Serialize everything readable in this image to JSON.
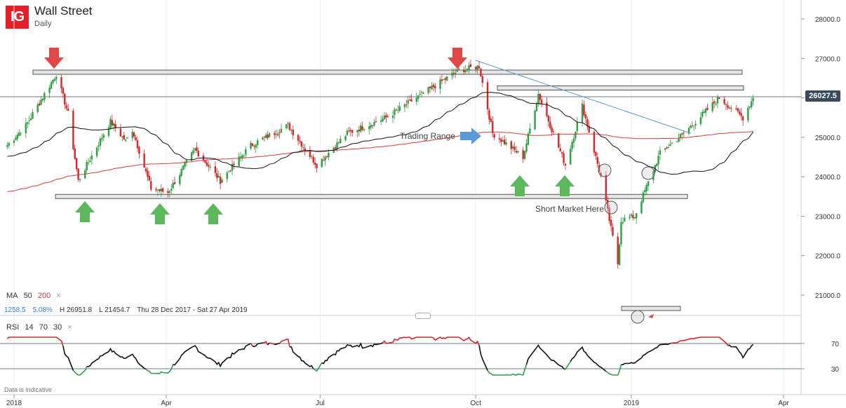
{
  "header": {
    "title": "Wall Street",
    "subtitle": "Daily",
    "logo_text": "IG"
  },
  "ma_legend": {
    "label": "MA",
    "period1": "50",
    "period2": "200",
    "close": "×"
  },
  "stats": {
    "change": "1258.5",
    "change_pct": "5.08%",
    "high": "H 26951.8",
    "low": "L 21454.7",
    "range": "Thu 28 Dec 2017 - Sat 27 Apr 2019"
  },
  "rsi_legend": {
    "label": "RSI",
    "p1": "14",
    "p2": "70",
    "p3": "30",
    "close": "×"
  },
  "disclaimer": "Data is indicative",
  "current_price": "26027.5",
  "colors": {
    "up": "#2ea043",
    "down": "#d9252a",
    "ma50": "#111111",
    "ma200": "#d63a3a",
    "trend": "#5b9bd5",
    "arrow_green": "#5cb85c",
    "arrow_red": "#e04848",
    "arrow_blue": "#5b9bd5",
    "price_tag": "#3a4a5c"
  },
  "chart_data": {
    "type": "candlestick",
    "title": "Wall Street",
    "subtitle": "Daily",
    "y_axis": {
      "ticks": [
        "21000.0",
        "22000.0",
        "23000.0",
        "24000.0",
        "25000.0",
        "26000.0",
        "27000.0",
        "28000.0"
      ],
      "range": [
        20500,
        28300
      ]
    },
    "x_axis": {
      "ticks": [
        "2018",
        "Apr",
        "Jul",
        "Oct",
        "2019",
        "Apr"
      ]
    },
    "price_anchors": [
      [
        "2017-12-28",
        24800
      ],
      [
        "2018-01-08",
        25300
      ],
      [
        "2018-01-26",
        26600
      ],
      [
        "2018-02-02",
        25600
      ],
      [
        "2018-02-08",
        23900
      ],
      [
        "2018-02-27",
        25400
      ],
      [
        "2018-03-08",
        24900
      ],
      [
        "2018-03-12",
        25200
      ],
      [
        "2018-03-23",
        23700
      ],
      [
        "2018-04-02",
        23600
      ],
      [
        "2018-04-18",
        24700
      ],
      [
        "2018-05-03",
        23900
      ],
      [
        "2018-05-21",
        24800
      ],
      [
        "2018-06-12",
        25300
      ],
      [
        "2018-06-29",
        24300
      ],
      [
        "2018-07-17",
        25100
      ],
      [
        "2018-08-09",
        25500
      ],
      [
        "2018-09-21",
        26700
      ],
      [
        "2018-10-03",
        26800
      ],
      [
        "2018-10-11",
        25100
      ],
      [
        "2018-10-29",
        24500
      ],
      [
        "2018-11-07",
        26100
      ],
      [
        "2018-11-23",
        24300
      ],
      [
        "2018-12-03",
        25800
      ],
      [
        "2018-12-14",
        24000
      ],
      [
        "2018-12-24",
        21800
      ],
      [
        "2018-12-26",
        22900
      ],
      [
        "2019-01-03",
        23000
      ],
      [
        "2019-01-18",
        24600
      ],
      [
        "2019-02-01",
        25100
      ],
      [
        "2019-02-22",
        26000
      ],
      [
        "2019-03-08",
        25500
      ],
      [
        "2019-03-14",
        26000
      ]
    ],
    "ma_periods": [
      50,
      200
    ],
    "rsi": {
      "period": 14,
      "overbought": 70,
      "oversold": 30,
      "axis_ticks": [
        "70",
        "30"
      ]
    },
    "annotations": {
      "texts": [
        "Trading Range",
        "Short Market Here"
      ],
      "support_line": 23500,
      "resistance_line": 26650,
      "resistance_line_2": 26250,
      "current_price_line": 26027.5
    }
  }
}
